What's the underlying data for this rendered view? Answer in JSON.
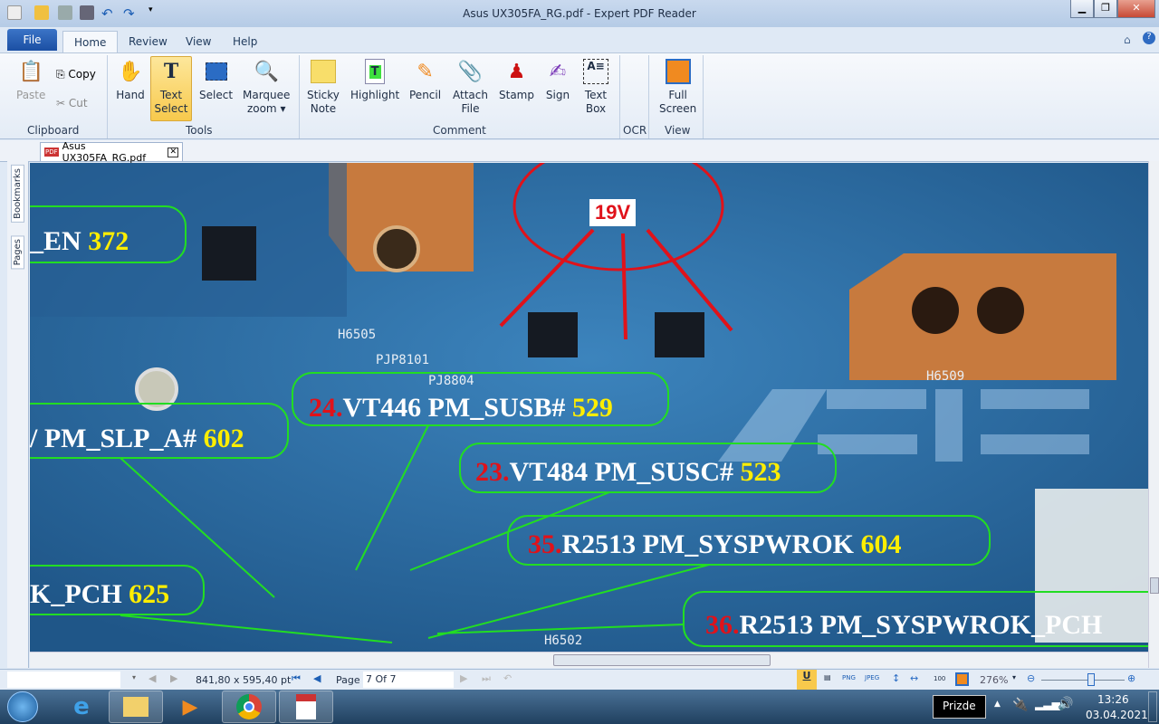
{
  "window": {
    "title": "Asus UX305FA_RG.pdf - Expert PDF Reader",
    "min": "▁",
    "max": "❐",
    "close": "✕"
  },
  "menu": {
    "file": "File",
    "tabs": [
      "Home",
      "Review",
      "View",
      "Help"
    ]
  },
  "ribbon": {
    "clipboard": {
      "paste": "Paste",
      "copy": "Copy",
      "cut": "Cut",
      "group": "Clipboard"
    },
    "tools": {
      "hand": "Hand",
      "text_select": [
        "Text",
        "Select"
      ],
      "select": "Select",
      "marquee": [
        "Marquee",
        "zoom ▾"
      ],
      "group": "Tools"
    },
    "comment": {
      "sticky": [
        "Sticky",
        "Note"
      ],
      "highlight": "Highlight",
      "pencil": "Pencil",
      "attach": [
        "Attach",
        "File"
      ],
      "stamp": "Stamp",
      "sign": "Sign",
      "textbox": [
        "Text",
        "Box"
      ],
      "group": "Comment"
    },
    "ocr": {
      "group": "OCR"
    },
    "view": {
      "fullscreen": [
        "Full",
        "Screen"
      ],
      "group": "View"
    }
  },
  "doc_tab": {
    "name": "Asus UX305FA_RG.pdf"
  },
  "side_panel": {
    "bookmarks": "Bookmarks",
    "pages": "Pages"
  },
  "pdf": {
    "voltage": "19V",
    "labels": [
      {
        "pre": "",
        "text": "_EN ",
        "val": "372"
      },
      {
        "pre": "",
        "text": "/ PM_SLP_A# ",
        "val": "602"
      },
      {
        "pre": "24.",
        "text": "VT446 PM_SUSB# ",
        "val": "529"
      },
      {
        "pre": "23.",
        "text": "VT484 PM_SUSC# ",
        "val": "523"
      },
      {
        "pre": "35.",
        "text": "R2513 PM_SYSPWROK ",
        "val": "604"
      },
      {
        "pre": "",
        "text": "K_PCH ",
        "val": "625"
      },
      {
        "pre": "36.",
        "text": "R2513 PM_SYSPWROK_PCH",
        "val": ""
      }
    ],
    "silkscreen": [
      "H6505",
      "PJP8101",
      "PJ8804",
      "H6509",
      "H6502"
    ]
  },
  "status": {
    "page_size": "841,80 x 595,40 pt",
    "page_label": "Page",
    "page_value": "7 Of 7",
    "zoom": "276%",
    "zoom_fraction": 0.6
  },
  "taskbar": {
    "tooltip": "Prizde",
    "time": "13:26",
    "date": "03.04.2021"
  },
  "colors": {
    "accent": "#1b4fa3",
    "label_red": "#e0121a",
    "label_yellow": "#ffee00",
    "outline_green": "#22dd22"
  }
}
